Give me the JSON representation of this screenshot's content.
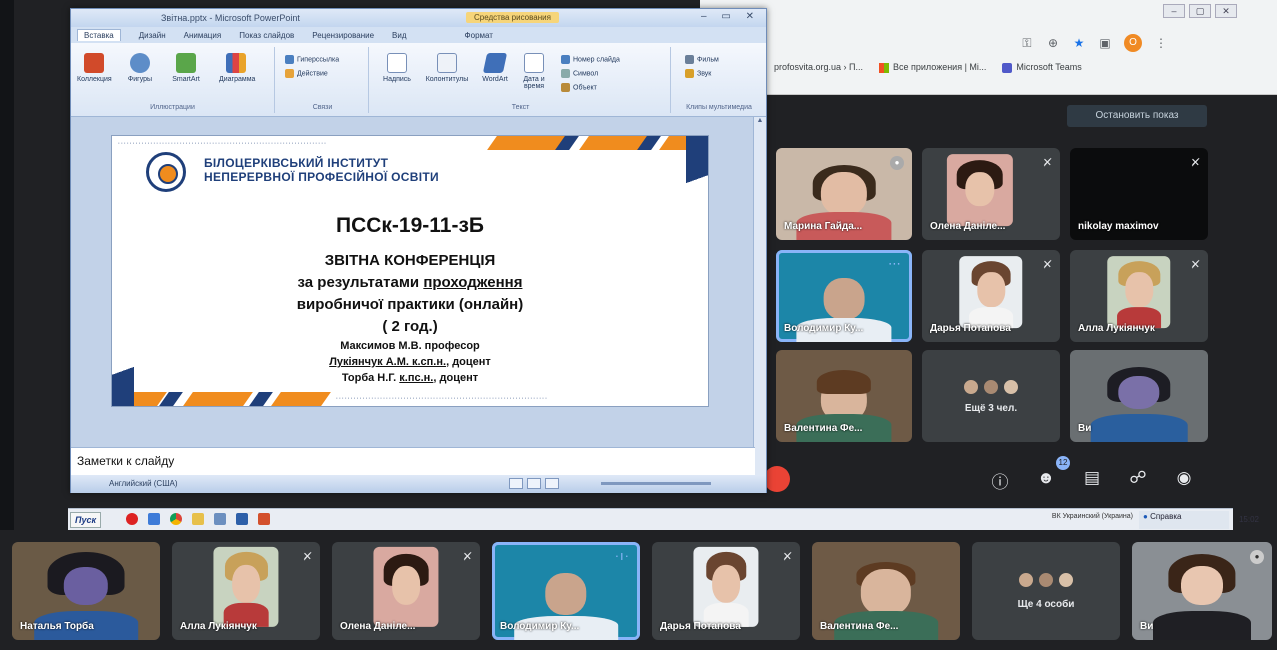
{
  "powerpoint": {
    "title": "Звітна.pptx - Microsoft PowerPoint",
    "context_tab": "Средства рисования",
    "tabs": [
      "Вставка",
      "Дизайн",
      "Анимация",
      "Показ слайдов",
      "Рецензирование",
      "Вид",
      "Формат"
    ],
    "ribbon": {
      "illustrations": [
        "Коллекция",
        "Фигуры",
        "SmartArt",
        "Диаграмма"
      ],
      "illustrations_title": "Иллюстрации",
      "links": [
        "Гиперссылка",
        "Действие"
      ],
      "links_title": "Связи",
      "text_buttons": [
        "Надпись",
        "Колонтитулы",
        "WordArt",
        "Дата и время"
      ],
      "text_small": [
        "Номер слайда",
        "Символ",
        "Объект"
      ],
      "text_title": "Текст",
      "media": [
        "Фильм",
        "Звук"
      ],
      "media_title": "Клипы мультимедиа"
    },
    "slide": {
      "institute_line1": "БІЛОЦЕРКІВСЬКИЙ ІНСТИТУТ",
      "institute_line2": "НЕПЕРЕРВНОЇ ПРОФЕСІЙНОЇ ОСВІТИ",
      "group": "ПССк-19-11-зБ",
      "heading": "ЗВІТНА КОНФЕРЕНЦІЯ",
      "line2_pre": "за результатами ",
      "line2_u": "проходження",
      "line3": "виробничої практики  (онлайн)",
      "line4": "( 2 год.)",
      "author1": "Максимов М.В. професор",
      "author2_u": "Лукіянчук А.М. к.сп.н.",
      "author2_rest": ", доцент",
      "author3_pre": "Торба Н.Г. ",
      "author3_u": "к.пс.н.",
      "author3_rest": ", доцент"
    },
    "notes_placeholder": "Заметки к слайду",
    "status_language": "Английский (США)"
  },
  "chrome": {
    "bookmarks": [
      "profosvita.org.ua › П...",
      "Все приложения | Mi...",
      "Microsoft Teams"
    ],
    "avatar_letter": "O"
  },
  "meet": {
    "stop_button": "Остановить показ",
    "grid": [
      {
        "name": "Марина Гайда...",
        "mic_off": false
      },
      {
        "name": "Олена Даніле...",
        "mic_off": true
      },
      {
        "name": "nikolay maximov",
        "mic_off": true
      },
      {
        "name": "Володимир Ку...",
        "mic_off": false,
        "active": true
      },
      {
        "name": "Дарья Потапова",
        "mic_off": true
      },
      {
        "name": "Алла Лукіянчук",
        "mic_off": true
      },
      {
        "name": "Валентина Фе...",
        "mic_off": false
      },
      {
        "more_label": "Ещё 3 чел."
      },
      {
        "name": "Ви",
        "mic_off": false
      }
    ],
    "participants_badge": "12",
    "controls": [
      "info-icon",
      "people-icon",
      "chat-icon",
      "activities-icon",
      "lock-icon"
    ]
  },
  "taskbar": {
    "start_label": "Пуск",
    "tray_language": "ВК Украинский (Украина)",
    "tray_help": "Справка",
    "clock": "15:02"
  },
  "filmstrip": [
    {
      "name": "Наталья Торба"
    },
    {
      "name": "Алла Лукіянчук",
      "mic_off": true
    },
    {
      "name": "Олена Даніле...",
      "mic_off": true
    },
    {
      "name": "Володимир Ку...",
      "active": true
    },
    {
      "name": "Дарья Потапова",
      "mic_off": true
    },
    {
      "name": "Валентина Фе..."
    },
    {
      "more_label": "Ще 4 особи"
    },
    {
      "name": "Ви"
    }
  ],
  "colors": {
    "meet_bg": "#202124",
    "tile_bg": "#3c4043",
    "active_tile": "#1c86a8",
    "slide_navy": "#1f3f7a",
    "slide_orange": "#f08c1e",
    "ppt_frame": "#dfe8f5"
  }
}
